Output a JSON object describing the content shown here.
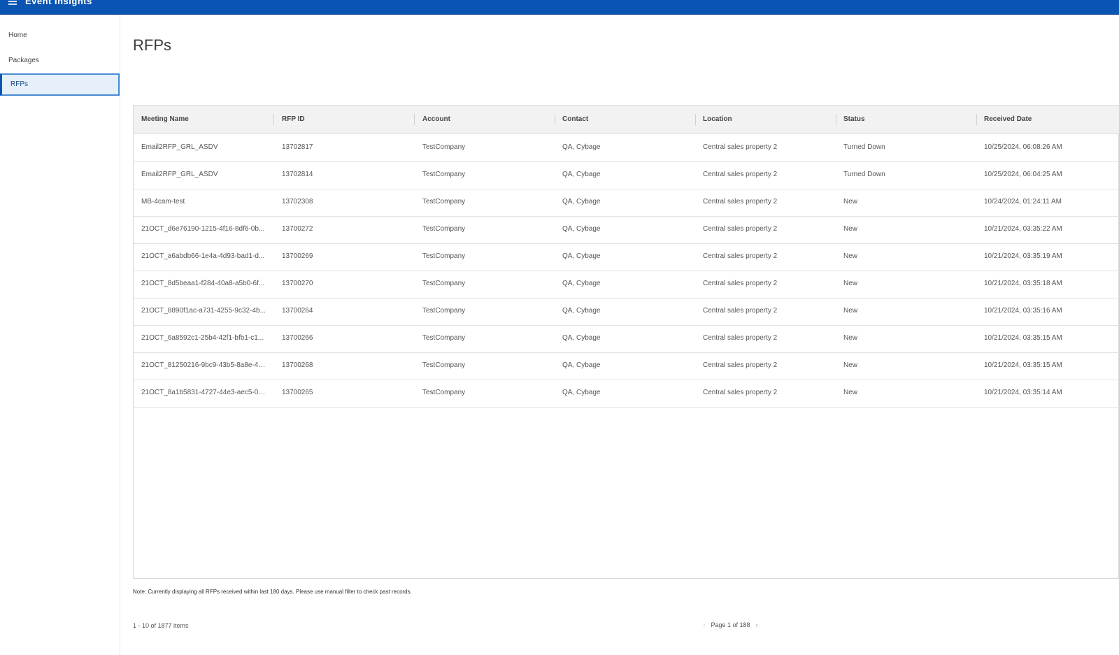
{
  "header": {
    "app_title": "Event Insights"
  },
  "sidebar": {
    "items": [
      {
        "label": "Home"
      },
      {
        "label": "Packages"
      },
      {
        "label": "RFPs"
      }
    ]
  },
  "page": {
    "title": "RFPs"
  },
  "grid": {
    "columns": [
      "Meeting Name",
      "RFP ID",
      "Account",
      "Contact",
      "Location",
      "Status",
      "Received Date"
    ],
    "rows": [
      [
        "Email2RFP_GRL_ASDV",
        "13702817",
        "TestCompany",
        "QA, Cybage",
        "Central sales property 2",
        "Turned Down",
        "10/25/2024, 06:08:26 AM"
      ],
      [
        "Email2RFP_GRL_ASDV",
        "13702814",
        "TestCompany",
        "QA, Cybage",
        "Central sales property 2",
        "Turned Down",
        "10/25/2024, 06:04:25 AM"
      ],
      [
        "MB-4cam-test",
        "13702308",
        "TestCompany",
        "QA, Cybage",
        "Central sales property 2",
        "New",
        "10/24/2024, 01:24:11 AM"
      ],
      [
        "21OCT_d6e76190-1215-4f16-8df6-0b...",
        "13700272",
        "TestCompany",
        "QA, Cybage",
        "Central sales property 2",
        "New",
        "10/21/2024, 03:35:22 AM"
      ],
      [
        "21OCT_a6abdb66-1e4a-4d93-bad1-d...",
        "13700269",
        "TestCompany",
        "QA, Cybage",
        "Central sales property 2",
        "New",
        "10/21/2024, 03:35:19 AM"
      ],
      [
        "21OCT_8d5beaa1-f284-40a8-a5b0-6f...",
        "13700270",
        "TestCompany",
        "QA, Cybage",
        "Central sales property 2",
        "New",
        "10/21/2024, 03:35:18 AM"
      ],
      [
        "21OCT_8890f1ac-a731-4255-9c32-4b...",
        "13700264",
        "TestCompany",
        "QA, Cybage",
        "Central sales property 2",
        "New",
        "10/21/2024, 03:35:16 AM"
      ],
      [
        "21OCT_6a8592c1-25b4-42f1-bfb1-c1...",
        "13700266",
        "TestCompany",
        "QA, Cybage",
        "Central sales property 2",
        "New",
        "10/21/2024, 03:35:15 AM"
      ],
      [
        "21OCT_81250216-9bc9-43b5-8a8e-48...",
        "13700268",
        "TestCompany",
        "QA, Cybage",
        "Central sales property 2",
        "New",
        "10/21/2024, 03:35:15 AM"
      ],
      [
        "21OCT_8a1b5831-4727-44e3-aec5-07...",
        "13700265",
        "TestCompany",
        "QA, Cybage",
        "Central sales property 2",
        "New",
        "10/21/2024, 03:35:14 AM"
      ]
    ]
  },
  "footer": {
    "note": "Note: Currently displaying all RFPs received within last 180 days. Please use manual filter to check past records.",
    "items_count": "1 - 10 of 1877 items",
    "page_info": "Page 1 of 188"
  },
  "colors": {
    "topbar": "#0a55b4",
    "active_nav_bg": "#e6f0fb",
    "header_bg": "#f2f2f2"
  }
}
